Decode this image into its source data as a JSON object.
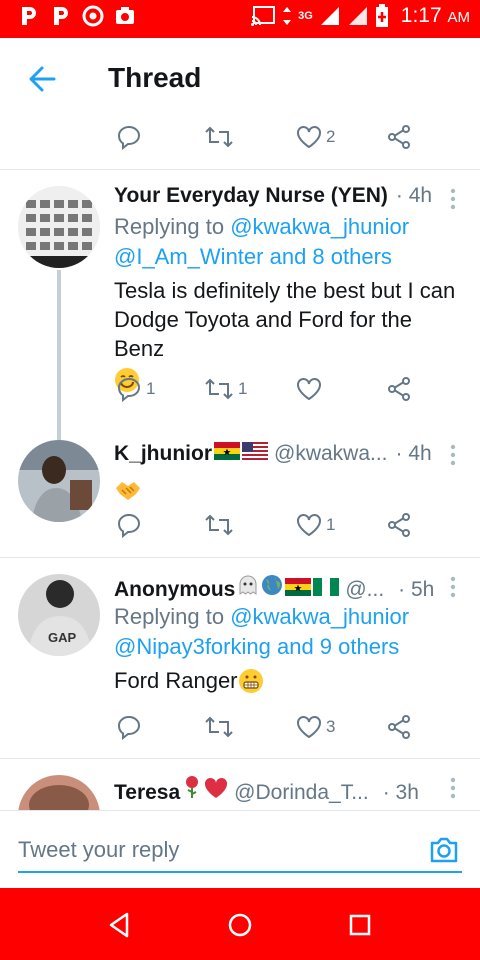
{
  "status_bar": {
    "time": "1:17",
    "ampm": "AM",
    "network": "3G"
  },
  "header": {
    "title": "Thread"
  },
  "top_actions": {
    "like_count": "2"
  },
  "tweets": [
    {
      "name": "Your Everyday Nurse (YEN)",
      "handle": "",
      "time": "· 4h",
      "reply_prefix": "Replying to ",
      "reply_user1": "@kwakwa_jhunior",
      "reply_user2": "@I_Am_Winter",
      "reply_others": " and 8 others",
      "text": "Tesla is definitely the best but I can Dodge Toyota and Ford for the Benz",
      "reply_count": "1",
      "retweet_count": "1",
      "like_count": ""
    },
    {
      "name": "K_jhunior",
      "handle": "@kwakwa...",
      "time": "· 4h",
      "text": "",
      "reply_count": "",
      "retweet_count": "",
      "like_count": "1"
    },
    {
      "name": "Anonymous",
      "handle": "@...",
      "time": "· 5h",
      "reply_prefix": "Replying to ",
      "reply_user1": "@kwakwa_jhunior",
      "reply_user2": "@Nipay3forking",
      "reply_others": " and 9 others",
      "text": "Ford Ranger",
      "reply_count": "",
      "retweet_count": "",
      "like_count": "3"
    },
    {
      "name": "Teresa",
      "handle": "@Dorinda_T...",
      "time": "· 3h"
    }
  ],
  "reply_box": {
    "placeholder": "Tweet your reply"
  },
  "colors": {
    "accent": "#1da1f2",
    "status_bar": "#ff0000",
    "secondary_text": "#657786"
  }
}
